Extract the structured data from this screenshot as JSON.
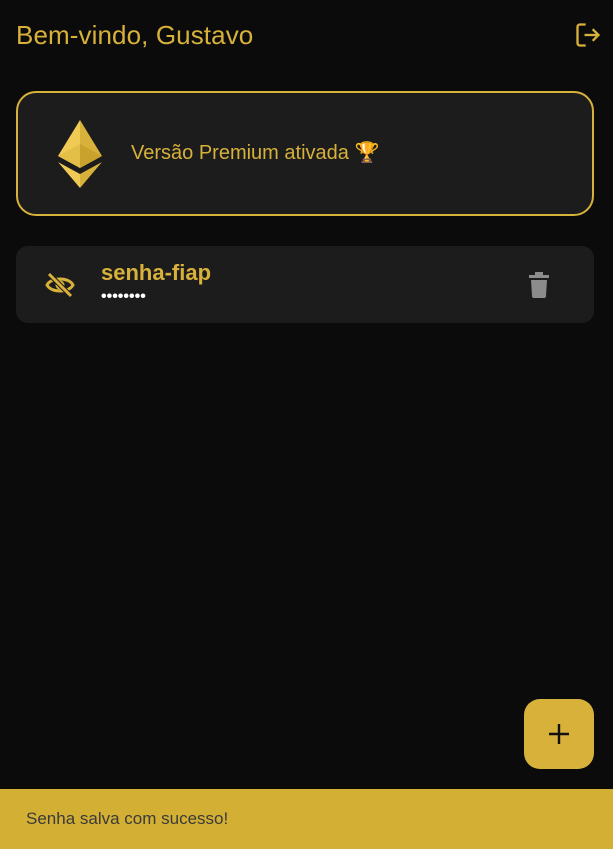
{
  "app_bar": {
    "title": "Bem-vindo, Gustavo",
    "logout_icon": "logout-icon"
  },
  "premium_banner": {
    "text": "Versão Premium ativada 🏆",
    "logo_icon": "ethereum-icon"
  },
  "passwords": [
    {
      "name": "senha-fiap",
      "masked_value": "••••••••",
      "visibility_icon": "eye-off-icon",
      "delete_icon": "trash-icon"
    }
  ],
  "fab": {
    "icon": "plus-icon",
    "label": "+"
  },
  "snackbar": {
    "message": "Senha salva com sucesso!"
  },
  "colors": {
    "background": "#0b0b0b",
    "accent": "#d7b13a",
    "card": "#1c1c1c",
    "snackbar": "#d3b034",
    "icon_gray": "#8c8c8c"
  }
}
